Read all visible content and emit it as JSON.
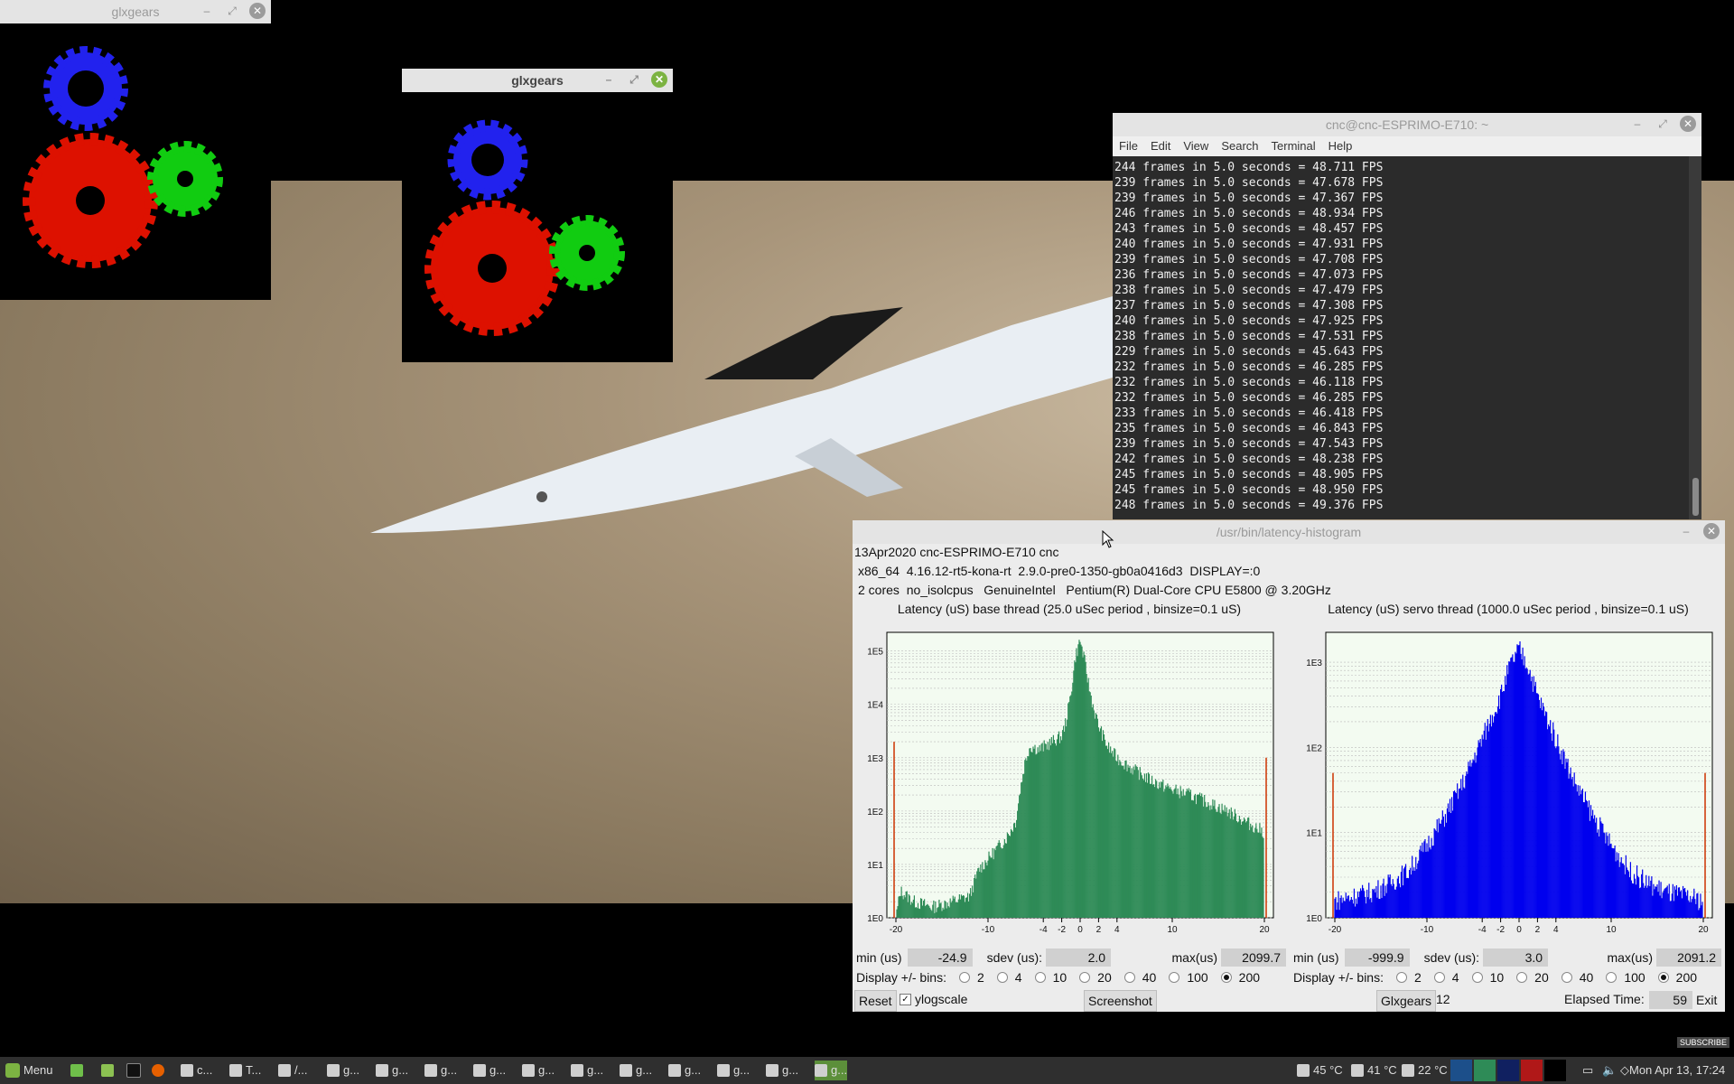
{
  "glx1": {
    "title": "glxgears"
  },
  "glx2": {
    "title": "glxgears"
  },
  "terminal": {
    "title": "cnc@cnc-ESPRIMO-E710: ~",
    "menu": [
      "File",
      "Edit",
      "View",
      "Search",
      "Terminal",
      "Help"
    ],
    "lines": [
      "244 frames in 5.0 seconds = 48.711 FPS",
      "239 frames in 5.0 seconds = 47.678 FPS",
      "239 frames in 5.0 seconds = 47.367 FPS",
      "246 frames in 5.0 seconds = 48.934 FPS",
      "243 frames in 5.0 seconds = 48.457 FPS",
      "240 frames in 5.0 seconds = 47.931 FPS",
      "239 frames in 5.0 seconds = 47.708 FPS",
      "236 frames in 5.0 seconds = 47.073 FPS",
      "238 frames in 5.0 seconds = 47.479 FPS",
      "237 frames in 5.0 seconds = 47.308 FPS",
      "240 frames in 5.0 seconds = 47.925 FPS",
      "238 frames in 5.0 seconds = 47.531 FPS",
      "229 frames in 5.0 seconds = 45.643 FPS",
      "232 frames in 5.0 seconds = 46.285 FPS",
      "232 frames in 5.0 seconds = 46.118 FPS",
      "232 frames in 5.0 seconds = 46.285 FPS",
      "233 frames in 5.0 seconds = 46.418 FPS",
      "235 frames in 5.0 seconds = 46.843 FPS",
      "239 frames in 5.0 seconds = 47.543 FPS",
      "242 frames in 5.0 seconds = 48.238 FPS",
      "245 frames in 5.0 seconds = 48.905 FPS",
      "245 frames in 5.0 seconds = 48.950 FPS",
      "248 frames in 5.0 seconds = 49.376 FPS"
    ]
  },
  "latency": {
    "title": "/usr/bin/latency-histogram",
    "info1": "13Apr2020 cnc-ESPRIMO-E710 cnc",
    "info2": "x86_64  4.16.12-rt5-kona-rt  2.9.0-pre0-1350-gb0a0416d3  DISPLAY=:0",
    "info3": "2 cores  no_isolcpus   GenuineIntel   Pentium(R) Dual-Core CPU E5800 @ 3.20GHz",
    "base": {
      "title": "Latency (uS) base thread (25.0 uSec period , binsize=0.1 uS)",
      "min_label": "min (us)",
      "min": "-24.9",
      "sdev_label": "sdev (us):",
      "sdev": "2.0",
      "max_label": "max(us)",
      "max": "2099.7"
    },
    "servo": {
      "title": "Latency (uS) servo thread (1000.0 uSec period , binsize=0.1 uS)",
      "min_label": "min (us)",
      "min": "-999.9",
      "sdev_label": "sdev (us):",
      "sdev": "3.0",
      "max_label": "max(us)",
      "max": "2091.2"
    },
    "bins_label": "Display +/- bins:",
    "bins_options": [
      "2",
      "4",
      "10",
      "20",
      "40",
      "100",
      "200"
    ],
    "bins_selected": "200",
    "reset": "Reset",
    "ylogscale": "ylogscale",
    "screenshot": "Screenshot",
    "glxgears_label": "Glxgears",
    "glxgears_count": "12",
    "elapsed_label": "Elapsed Time:",
    "elapsed": "59",
    "exit": "Exit"
  },
  "chart_data": [
    {
      "type": "bar",
      "title": "Latency (uS) base thread (25.0 uSec period , binsize=0.1 uS)",
      "xlim": [
        -20,
        20
      ],
      "x_ticks": [
        "-20",
        "-10",
        "-4",
        "-2",
        "0",
        "2",
        "4",
        "10",
        "20"
      ],
      "y_scale": "log",
      "y_ticks": [
        "1E0",
        "1E1",
        "1E2",
        "1E3",
        "1E4",
        "1E5"
      ],
      "color": "#2e8b57",
      "profile": [
        [
          -20,
          0.0
        ],
        [
          -19.5,
          0.5
        ],
        [
          -18,
          0.3
        ],
        [
          -16,
          0.2
        ],
        [
          -14,
          0.3
        ],
        [
          -12,
          0.4
        ],
        [
          -11,
          0.9
        ],
        [
          -10,
          1.1
        ],
        [
          -9,
          1.3
        ],
        [
          -8,
          1.5
        ],
        [
          -7,
          1.8
        ],
        [
          -6.5,
          2.4
        ],
        [
          -6,
          2.9
        ],
        [
          -5.5,
          3.2
        ],
        [
          -5,
          3.2
        ],
        [
          -4.5,
          3.15
        ],
        [
          -4,
          3.2
        ],
        [
          -3,
          3.3
        ],
        [
          -2,
          3.4
        ],
        [
          -1.5,
          3.7
        ],
        [
          -1,
          4.2
        ],
        [
          -0.5,
          4.9
        ],
        [
          0,
          5.2
        ],
        [
          0.5,
          4.8
        ],
        [
          1,
          4.3
        ],
        [
          1.5,
          3.9
        ],
        [
          2,
          3.6
        ],
        [
          3,
          3.2
        ],
        [
          4,
          3.0
        ],
        [
          6,
          2.75
        ],
        [
          8,
          2.55
        ],
        [
          10,
          2.4
        ],
        [
          12,
          2.3
        ],
        [
          14,
          2.15
        ],
        [
          16,
          2.0
        ],
        [
          18,
          1.8
        ],
        [
          20,
          1.6
        ]
      ]
    },
    {
      "type": "bar",
      "title": "Latency (uS) servo thread (1000.0 uSec period , binsize=0.1 uS)",
      "xlim": [
        -20,
        20
      ],
      "x_ticks": [
        "-20",
        "-10",
        "-4",
        "-2",
        "0",
        "2",
        "4",
        "10",
        "20"
      ],
      "y_scale": "log",
      "y_ticks": [
        "1E0",
        "1E1",
        "1E2",
        "1E3"
      ],
      "color": "#0000ee",
      "profile": [
        [
          -20,
          0.2
        ],
        [
          -18,
          0.25
        ],
        [
          -16,
          0.3
        ],
        [
          -14,
          0.4
        ],
        [
          -12,
          0.55
        ],
        [
          -10,
          0.85
        ],
        [
          -8,
          1.2
        ],
        [
          -6,
          1.6
        ],
        [
          -4,
          2.1
        ],
        [
          -2,
          2.6
        ],
        [
          -1,
          2.95
        ],
        [
          0,
          3.15
        ],
        [
          1,
          2.95
        ],
        [
          2,
          2.6
        ],
        [
          4,
          2.1
        ],
        [
          6,
          1.6
        ],
        [
          8,
          1.2
        ],
        [
          10,
          0.85
        ],
        [
          12,
          0.55
        ],
        [
          14,
          0.4
        ],
        [
          16,
          0.3
        ],
        [
          18,
          0.25
        ],
        [
          20,
          0.2
        ]
      ]
    }
  ],
  "taskbar": {
    "menu_label": "Menu",
    "items": [
      "c...",
      "T...",
      "/...",
      "g...",
      "g...",
      "g...",
      "g...",
      "g...",
      "g...",
      "g...",
      "g...",
      "g...",
      "g...",
      "g..."
    ],
    "temps": [
      "45 °C",
      "41 °C",
      "22 °C"
    ],
    "clock": "Mon Apr 13, 17:24",
    "subscribe": "SUBSCRIBE"
  }
}
